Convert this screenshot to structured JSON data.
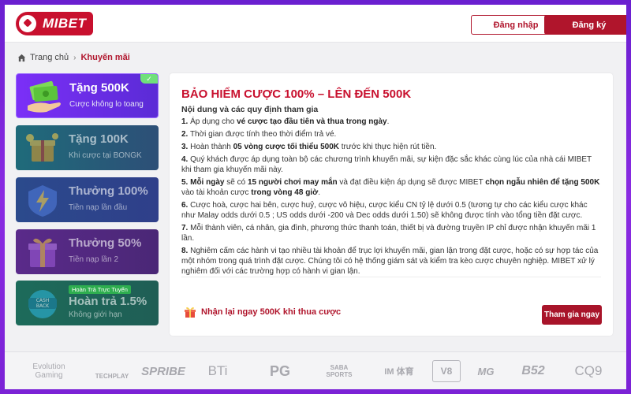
{
  "brand": {
    "name": "MIBET"
  },
  "header": {
    "login_label": "Đăng nhập",
    "register_label": "Đăng ký"
  },
  "breadcrumb": {
    "home": "Trang chủ",
    "current": "Khuyến mãi"
  },
  "promos": [
    {
      "title": "Tặng 500K",
      "subtitle": "Cược không lo toang",
      "active": true
    },
    {
      "title": "Tặng 100K",
      "subtitle": "Khi cược tại BONGK",
      "active": false
    },
    {
      "title": "Thưởng 100%",
      "subtitle": "Tiền nạp lần đầu",
      "active": false
    },
    {
      "title": "Thưởng 50%",
      "subtitle": "Tiền nạp lần 2",
      "active": false
    },
    {
      "title": "Hoàn trả 1.5%",
      "subtitle": "Không giới hạn",
      "tag": "Hoàn Trả Trực Tuyến",
      "active": false
    }
  ],
  "detail": {
    "title": "BẢO HIỂM CƯỢC 100% – LÊN ĐẾN 500K",
    "subtitle": "Nội dung và các quy định tham gia",
    "rules": [
      {
        "n": "1.",
        "parts": [
          {
            "t": " Áp dụng cho "
          },
          {
            "b": "vé cược tạo đầu tiên và thua trong ngày"
          },
          {
            "t": "."
          }
        ]
      },
      {
        "n": "2.",
        "parts": [
          {
            "t": " Thời gian được tính theo thời điểm trả vé."
          }
        ]
      },
      {
        "n": "3.",
        "parts": [
          {
            "t": " Hoàn thành "
          },
          {
            "b": "05 vòng cược tối thiểu 500K"
          },
          {
            "t": " trước khi thực hiện rút tiền."
          }
        ]
      },
      {
        "n": "4.",
        "parts": [
          {
            "t": " Quý khách được áp dụng toàn bộ các chương trình khuyến mãi, sự kiện đặc sắc khác cùng lúc của nhà cái MIBET khi tham gia khuyến mãi này."
          }
        ]
      },
      {
        "n": "5.",
        "parts": [
          {
            "b": " Mỗi ngày"
          },
          {
            "t": " sẽ có "
          },
          {
            "b": "15 người chơi may mắn"
          },
          {
            "t": " và đạt điều kiện áp dụng sẽ được MIBET "
          },
          {
            "b": "chọn ngẫu nhiên để tặng 500K"
          },
          {
            "t": " vào tài khoản cược "
          },
          {
            "b": "trong vòng 48 giờ"
          },
          {
            "t": "."
          }
        ]
      },
      {
        "n": "6.",
        "parts": [
          {
            "t": " Cược hoà, cược hai bên, cược huỷ, cược vô hiệu, cược kiểu CN tỷ lệ dưới 0.5 (tương tự cho các kiểu cược khác như Malay odds dưới 0.5 ; US odds dưới -200 và Dec odds dưới 1.50) sẽ không được tính vào tổng tiền đặt cược."
          }
        ]
      },
      {
        "n": "7.",
        "parts": [
          {
            "t": " Mỗi thành viên, cá nhân, gia đình, phương thức thanh toán, thiết bị và đường truyền IP chỉ được nhận khuyến mãi 1 lần."
          }
        ]
      },
      {
        "n": "8.",
        "parts": [
          {
            "t": " Nghiêm cấm các hành vi tạo nhiều tài khoản để trục lợi khuyến mãi, gian lận trong đặt cược, hoặc có sự hợp tác của một nhóm trong quá trình đặt cược. Chúng tôi có hệ thống giám sát và kiểm tra kèo cược chuyên nghiệp. MIBET xử lý nghiêm đối với các trường hợp có hành vi gian lận."
          }
        ]
      }
    ],
    "cta_text": "Nhận lại ngay 500K khi thua cược",
    "join_label": "Tham gia ngay"
  },
  "partners": [
    {
      "name": "Evolution Gaming",
      "label": "Evolution\nGaming"
    },
    {
      "name": "TechPlay",
      "label": "TECHPLAY"
    },
    {
      "name": "Spribe",
      "label": "SPRIBE"
    },
    {
      "name": "BTi",
      "label": "BTi"
    },
    {
      "name": "PG",
      "label": "PG"
    },
    {
      "name": "Saba Sports",
      "label": "SABA SPORTS"
    },
    {
      "name": "IM Sports",
      "label": "IM 体育"
    },
    {
      "name": "V8 Club",
      "label": "V8"
    },
    {
      "name": "Mega",
      "label": "MG"
    },
    {
      "name": "B52",
      "label": "B52"
    },
    {
      "name": "CQ9 Gaming",
      "label": "CQ9"
    }
  ],
  "colors": {
    "brand_red": "#c8102e",
    "button_red": "#a8142a",
    "purple_bg": "#7b22d6"
  }
}
